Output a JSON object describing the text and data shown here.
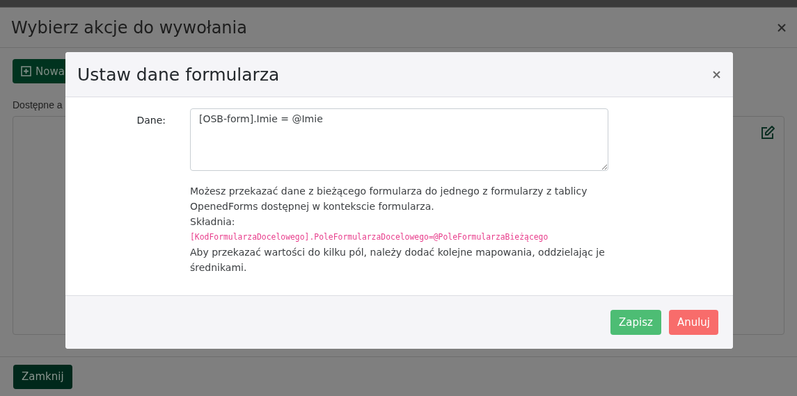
{
  "background_dialog": {
    "title": "Wybierz akcje do wywołania",
    "new_button": {
      "label": "Nowa"
    },
    "list_label": "Dostępne a",
    "close_button": {
      "label": "Zamknij"
    }
  },
  "modal": {
    "title": "Ustaw dane formularza",
    "field": {
      "label": "Dane:",
      "value": "[OSB-form].Imie = @Imie"
    },
    "help": [
      {
        "kind": "text",
        "text": "Możesz przekazać dane z bieżącego formularza do jednego z formularzy z tablicy OpenedForms dostępnej w kontekscie formularza."
      },
      {
        "kind": "text",
        "text": "Składnia:"
      },
      {
        "kind": "code",
        "text": "[KodFormularzaDocelowego].PoleFormularzaDocelowego=@PoleFormularzaBieżącego"
      },
      {
        "kind": "text",
        "text": "Aby przekazać wartości do kilku pól, należy dodać kolejne mapowania, oddzielając je średnikami."
      }
    ],
    "buttons": [
      {
        "kind": "save",
        "label": "Zapisz"
      },
      {
        "kind": "cancel",
        "label": "Anuluj"
      }
    ]
  }
}
